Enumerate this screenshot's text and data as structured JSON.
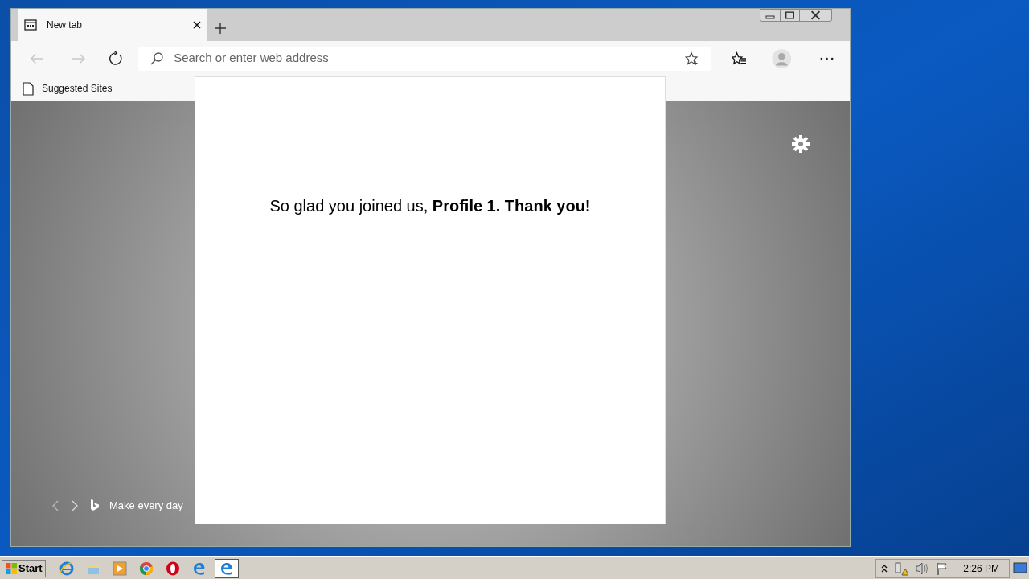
{
  "tabs": [
    {
      "label": "New tab",
      "selected": true
    }
  ],
  "address_bar": {
    "placeholder": "Search or enter web address"
  },
  "bookmarks": [
    {
      "label": "Suggested Sites"
    }
  ],
  "dialog": {
    "message": "So glad you joined us, **Profile 1. Thank you!**"
  },
  "new_tab_page": {
    "caption": "Make every day"
  },
  "taskbar": {
    "start": "Start",
    "clock": "2:26 PM"
  }
}
